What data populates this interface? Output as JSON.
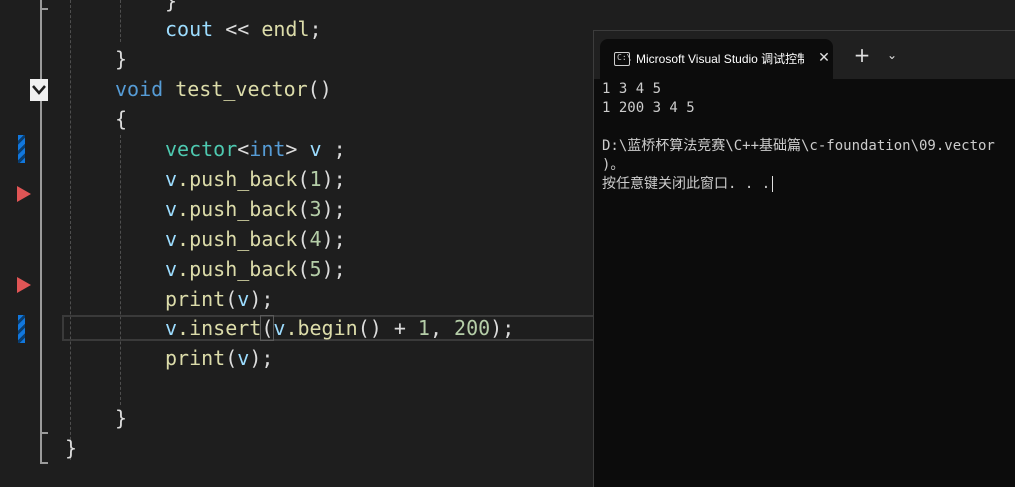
{
  "editor": {
    "lines": {
      "brace_top": "}",
      "cout": "cout",
      "shift": " << ",
      "endl": "endl",
      "semi": ";",
      "close_fn": "}",
      "void_kw": "void",
      "fn_name": "test_vector",
      "parens": "()",
      "open_brace": "{",
      "vector_type": "vector",
      "lt": "<",
      "int_kw": "int",
      "gt": ">",
      "v_decl": " v ",
      "decl_semi": ";",
      "pb1_obj": "v",
      "pb1_call": ".push_back",
      "pb1_open": "(",
      "pb1_arg": "1",
      "pb1_close": ");",
      "pb2_arg": "3",
      "pb3_arg": "4",
      "pb4_arg": "5",
      "print_fn": "print",
      "print_open": "(",
      "print_arg": "v",
      "print_close": ");",
      "ins_obj": "v",
      "ins_call": ".insert",
      "ins_open": "(",
      "ins_obj2": "v",
      "ins_begin": ".begin",
      "ins_begin_parens": "()",
      "ins_plus": " + ",
      "ins_one": "1",
      "ins_comma": ", ",
      "ins_200": "200",
      "ins_close": ");",
      "close_inner": "}",
      "close_outer": "}"
    }
  },
  "console": {
    "tab_title": "Microsoft Visual Studio 调试控制台",
    "tab_close": "✕",
    "new_tab": "+",
    "dropdown": "⌄",
    "output": [
      "1 3 4 5",
      "1 200 3 4 5",
      "",
      "D:\\蓝桥杯算法竞赛\\C++基础篇\\c-foundation\\09.vector",
      ")。",
      "按任意键关闭此窗口. . ."
    ]
  },
  "colors": {
    "background": "#1e1e1e",
    "keyword": "#569cd6",
    "function": "#dcdcaa",
    "type": "#4ec9b0",
    "variable": "#9cdcfe",
    "number": "#b5cea8",
    "breakpoint_arrow": "#e05555",
    "change_bar": "#1177dd",
    "console_bg": "#0c0c0c"
  }
}
